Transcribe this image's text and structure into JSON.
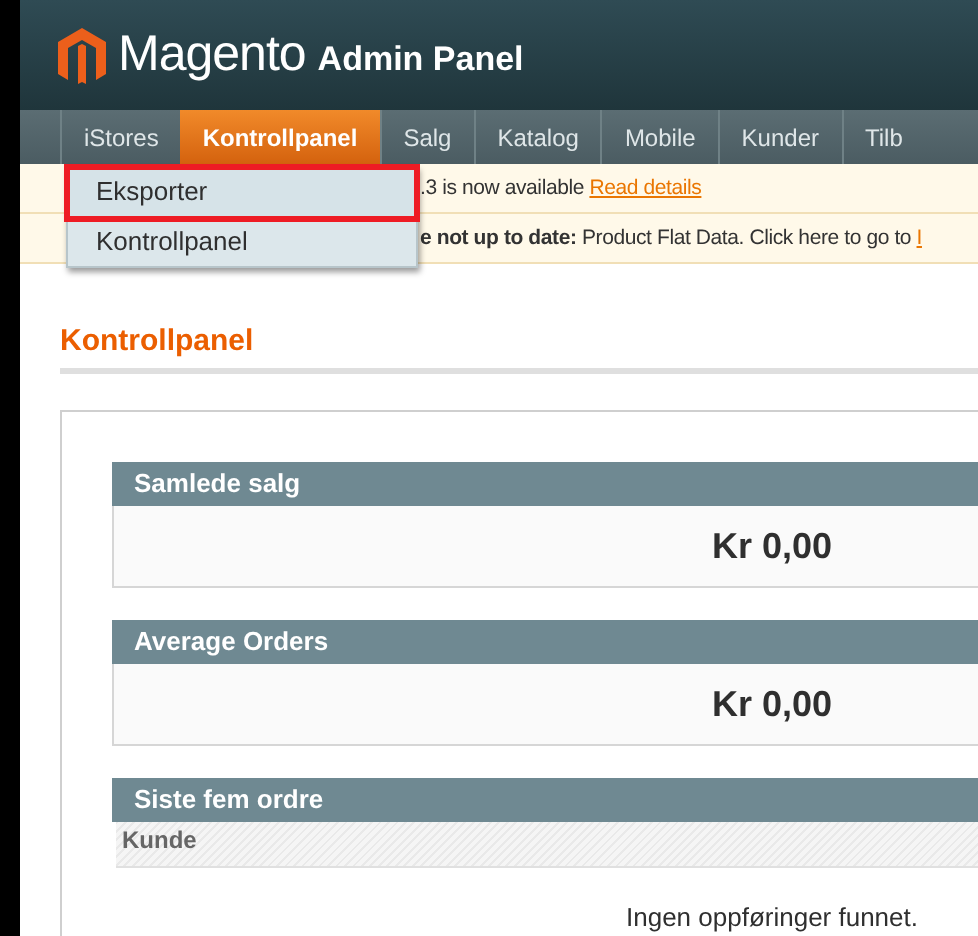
{
  "header": {
    "brand": "Magento",
    "subtitle": "Admin Panel"
  },
  "nav": [
    {
      "label": "iStores",
      "selected": false
    },
    {
      "label": "Kontrollpanel",
      "selected": true
    },
    {
      "label": "Salg",
      "selected": false
    },
    {
      "label": "Katalog",
      "selected": false
    },
    {
      "label": "Mobile",
      "selected": false
    },
    {
      "label": "Kunder",
      "selected": false
    },
    {
      "label": "Tilb",
      "selected": false
    }
  ],
  "dropdown": [
    {
      "label": "Eksporter",
      "selected": true
    },
    {
      "label": "Kontrollpanel",
      "selected": false
    }
  ],
  "notices": [
    {
      "text": ".3 is now available",
      "link": "Read details"
    },
    {
      "bold": "e not up to date:",
      "text": " Product Flat Data. Click here to go to",
      "link": "I"
    }
  ],
  "page_title": "Kontrollpanel",
  "stats": [
    {
      "title": "Samlede salg",
      "value": "Kr 0,00"
    },
    {
      "title": "Average Orders",
      "value": "Kr 0,00"
    }
  ],
  "orders": {
    "title": "Siste fem ordre",
    "columns": [
      "Kunde"
    ],
    "empty": "Ingen oppføringer funnet."
  }
}
